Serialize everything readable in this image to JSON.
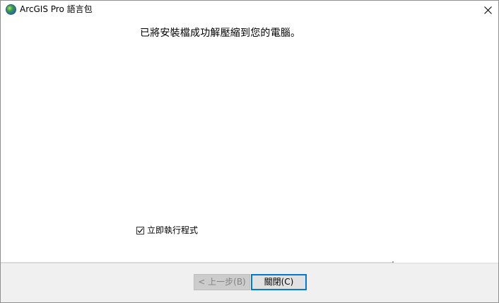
{
  "window": {
    "title": "ArcGIS Pro 語言包",
    "app_icon": "arcgis-globe-icon",
    "close_icon": "close-icon"
  },
  "main": {
    "message": "已將安裝檔成功解壓縮到您的電腦。",
    "run_now": {
      "label": "立即執行程式",
      "checked": true
    }
  },
  "footer": {
    "back_button": {
      "label": "< 上一步(B)",
      "enabled": false
    },
    "close_button": {
      "label": "關閉(C)",
      "enabled": true,
      "default": true
    }
  },
  "colors": {
    "focus_border": "#0078d7",
    "footer_bg": "#f0f0f0",
    "disabled_text": "#838383"
  }
}
